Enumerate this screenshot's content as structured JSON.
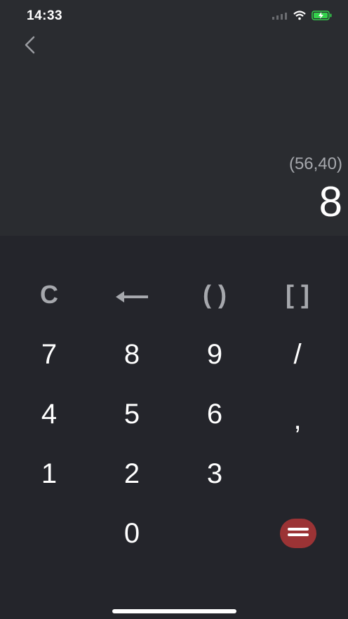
{
  "status_bar": {
    "time": "14:33",
    "icons": [
      "signal-icon",
      "wifi-icon",
      "battery-charging-icon"
    ],
    "battery_color": "#33d14b"
  },
  "navigation": {
    "back_icon": "chevron-left-icon"
  },
  "display": {
    "expression": "(56,40)",
    "result": "8"
  },
  "keypad": {
    "clear": "C",
    "backspace_icon": "arrow-left-icon",
    "parentheses": "( )",
    "brackets": "[ ]",
    "seven": "7",
    "eight": "8",
    "nine": "9",
    "slash": "/",
    "four": "4",
    "five": "5",
    "six": "6",
    "comma": ",",
    "one": "1",
    "two": "2",
    "three": "3",
    "zero": "0",
    "equals_icon": "equals-icon",
    "equals_color": "#9b3335"
  }
}
